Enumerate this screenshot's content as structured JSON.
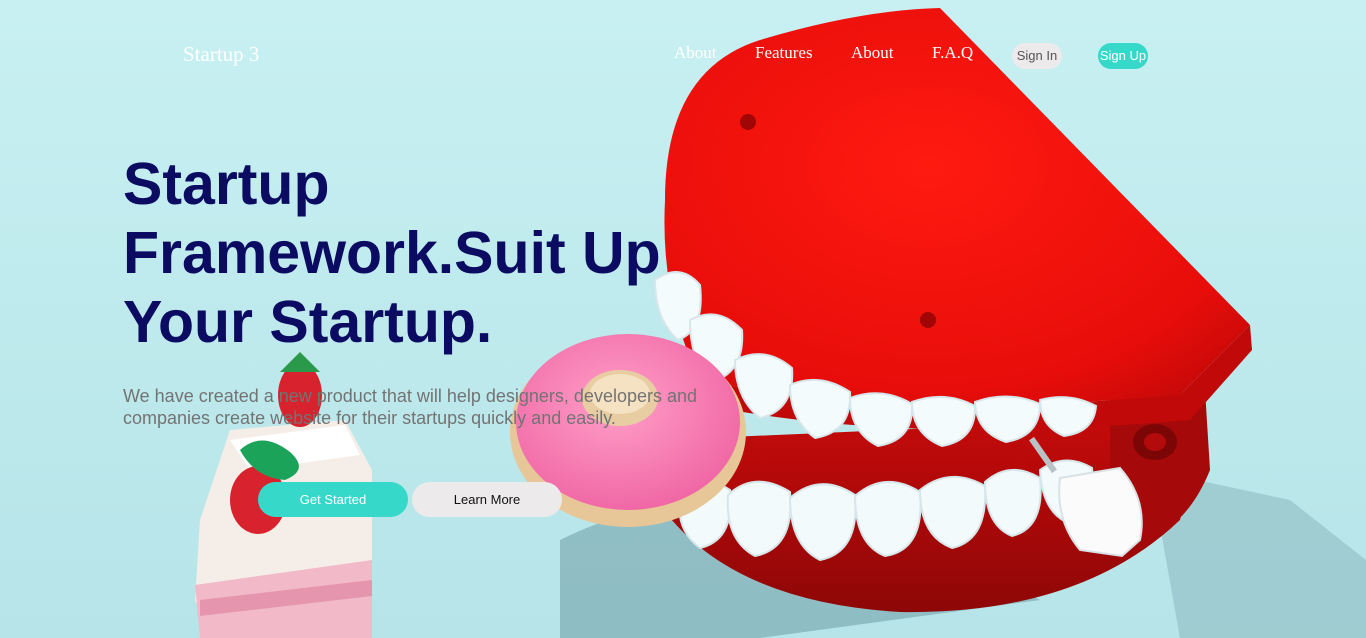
{
  "brand": "Startup 3",
  "nav": {
    "links": [
      "About",
      "Features",
      "About",
      "F.A.Q"
    ],
    "sign_in": "Sign In",
    "sign_up": "Sign Up"
  },
  "hero": {
    "headline_lines": [
      "Startup",
      "Framework.Suit Up",
      "Your Startup."
    ],
    "description": "We have created a new product that will help designers, developers and companies create website for their startups quickly and easily.",
    "primary_cta": "Get Started",
    "secondary_cta": "Learn More"
  },
  "colors": {
    "accent": "#36d9c9",
    "headline": "#0b0b62",
    "description": "#737373",
    "light_button": "#eceaea",
    "background": "#bfecef"
  },
  "background_image": "toy-wind-up-teeth-with-donut-and-cake-photo"
}
